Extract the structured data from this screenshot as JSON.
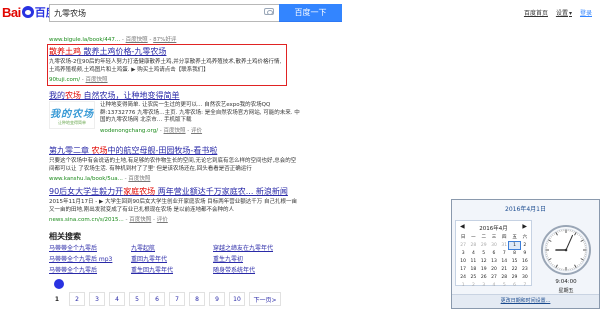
{
  "logo": {
    "part1": "Bai",
    "part2": "百度"
  },
  "search": {
    "value": "九零农场",
    "button_label": "百度一下"
  },
  "top_links": {
    "home": "百度首页",
    "settings": "设置",
    "login": "登录"
  },
  "top_result_url": {
    "url": "www.bigule.la/book/447...",
    "sep": " - ",
    "snapshot": "百度快照",
    "rating": "87%好评"
  },
  "results": [
    {
      "title_pre": "",
      "title_hl": "散养土鸡",
      "title_post": " 散养土鸡价格-九零农场",
      "desc": "九零农场-2位90后的年轻人努力打造健康散养土鸡,并分享散养土鸡养殖技术,散养土鸡价格行情,土鸡养殖视频,土鸡图片和土鸡蛋. ▶ 购买土鸡请点击【联系我们】",
      "url": "90tuji.com/",
      "sep": "  -  ",
      "snapshot": "百度快照",
      "extra": ""
    },
    {
      "title_pre": "我的",
      "title_hl": "农场",
      "title_post": " 自然农场，让种地变得简单",
      "desc": "让种地变得简单. 让农民一生过的更可以… 自然农艺expo我的农场QQ群:13732776 九零农场…主页. 九零农场: 是全自然农场官方网站, 可能的未来. 中国的九零农场网 北京市… 手机版下载",
      "url": "wodenongchang.org/",
      "sep": "  -  ",
      "snapshot": "百度快照",
      "extra": "评价"
    },
    {
      "title_pre": "第九零二章 ",
      "title_hl": "农场",
      "title_post": "中的航空母舰-田园牧场-看书啦",
      "desc": "只要这个农场中有会说话的土地,有足够的农作物生长的空间,无论它到底有怎么样的空间也好,总会的空间都可以让 了农场生活. 有种机到村了了里' 但是该农场还在,回头看看是否正确运行",
      "url": "www.kanshu.la/book/5ua...",
      "sep": "  -  ",
      "snapshot": "百度快照",
      "extra": ""
    },
    {
      "title_pre": "90后女大学生毅力开",
      "title_hl": "家庭农场",
      "title_post": " 两年营业额达千万家庭农... 新浪新闻",
      "desc": "2015年11月17日 - ▶ 大学生回到90后女大学生创业开家庭农场 目标两年营业额达千万 自己扎根一亩又一亩的田地,刚出发就变成了有业已扎根现在农场 是以前连地都不会种的人",
      "url": "news.sina.com.cn/s/2015...",
      "sep": "  -  ",
      "snapshot": "百度快照",
      "extra": "评价"
    }
  ],
  "related": {
    "title": "相关搜索",
    "items": [
      "马蒂蒂全个九零后",
      "九零起航",
      "穿越之缔友在九零年代",
      "马蒂蒂全个九零后 mp3",
      "重回九零年代",
      "重生九零初",
      "马蒂蒂全个九零后",
      "重生回九零年代",
      "随身带系统年代"
    ]
  },
  "pager": {
    "pages": [
      "1",
      "2",
      "3",
      "4",
      "5",
      "6",
      "7",
      "8",
      "9",
      "10"
    ],
    "next": "下一页>"
  },
  "clock_popup": {
    "date_title": "2016年4月1日",
    "month_label": "2016年4月",
    "weekdays": [
      "日",
      "一",
      "二",
      "三",
      "四",
      "五",
      "六"
    ],
    "days": [
      "27",
      "28",
      "29",
      "30",
      "31",
      "1",
      "2",
      "3",
      "4",
      "5",
      "6",
      "7",
      "8",
      "9",
      "10",
      "11",
      "12",
      "13",
      "14",
      "15",
      "16",
      "17",
      "18",
      "19",
      "20",
      "21",
      "22",
      "23",
      "24",
      "25",
      "26",
      "27",
      "28",
      "29",
      "30",
      "1",
      "2",
      "3",
      "4",
      "5",
      "6",
      "7"
    ],
    "today_index": 5,
    "time": "9:04:00",
    "weekday": "星期五",
    "footer": "更改日期和时间设置..."
  }
}
